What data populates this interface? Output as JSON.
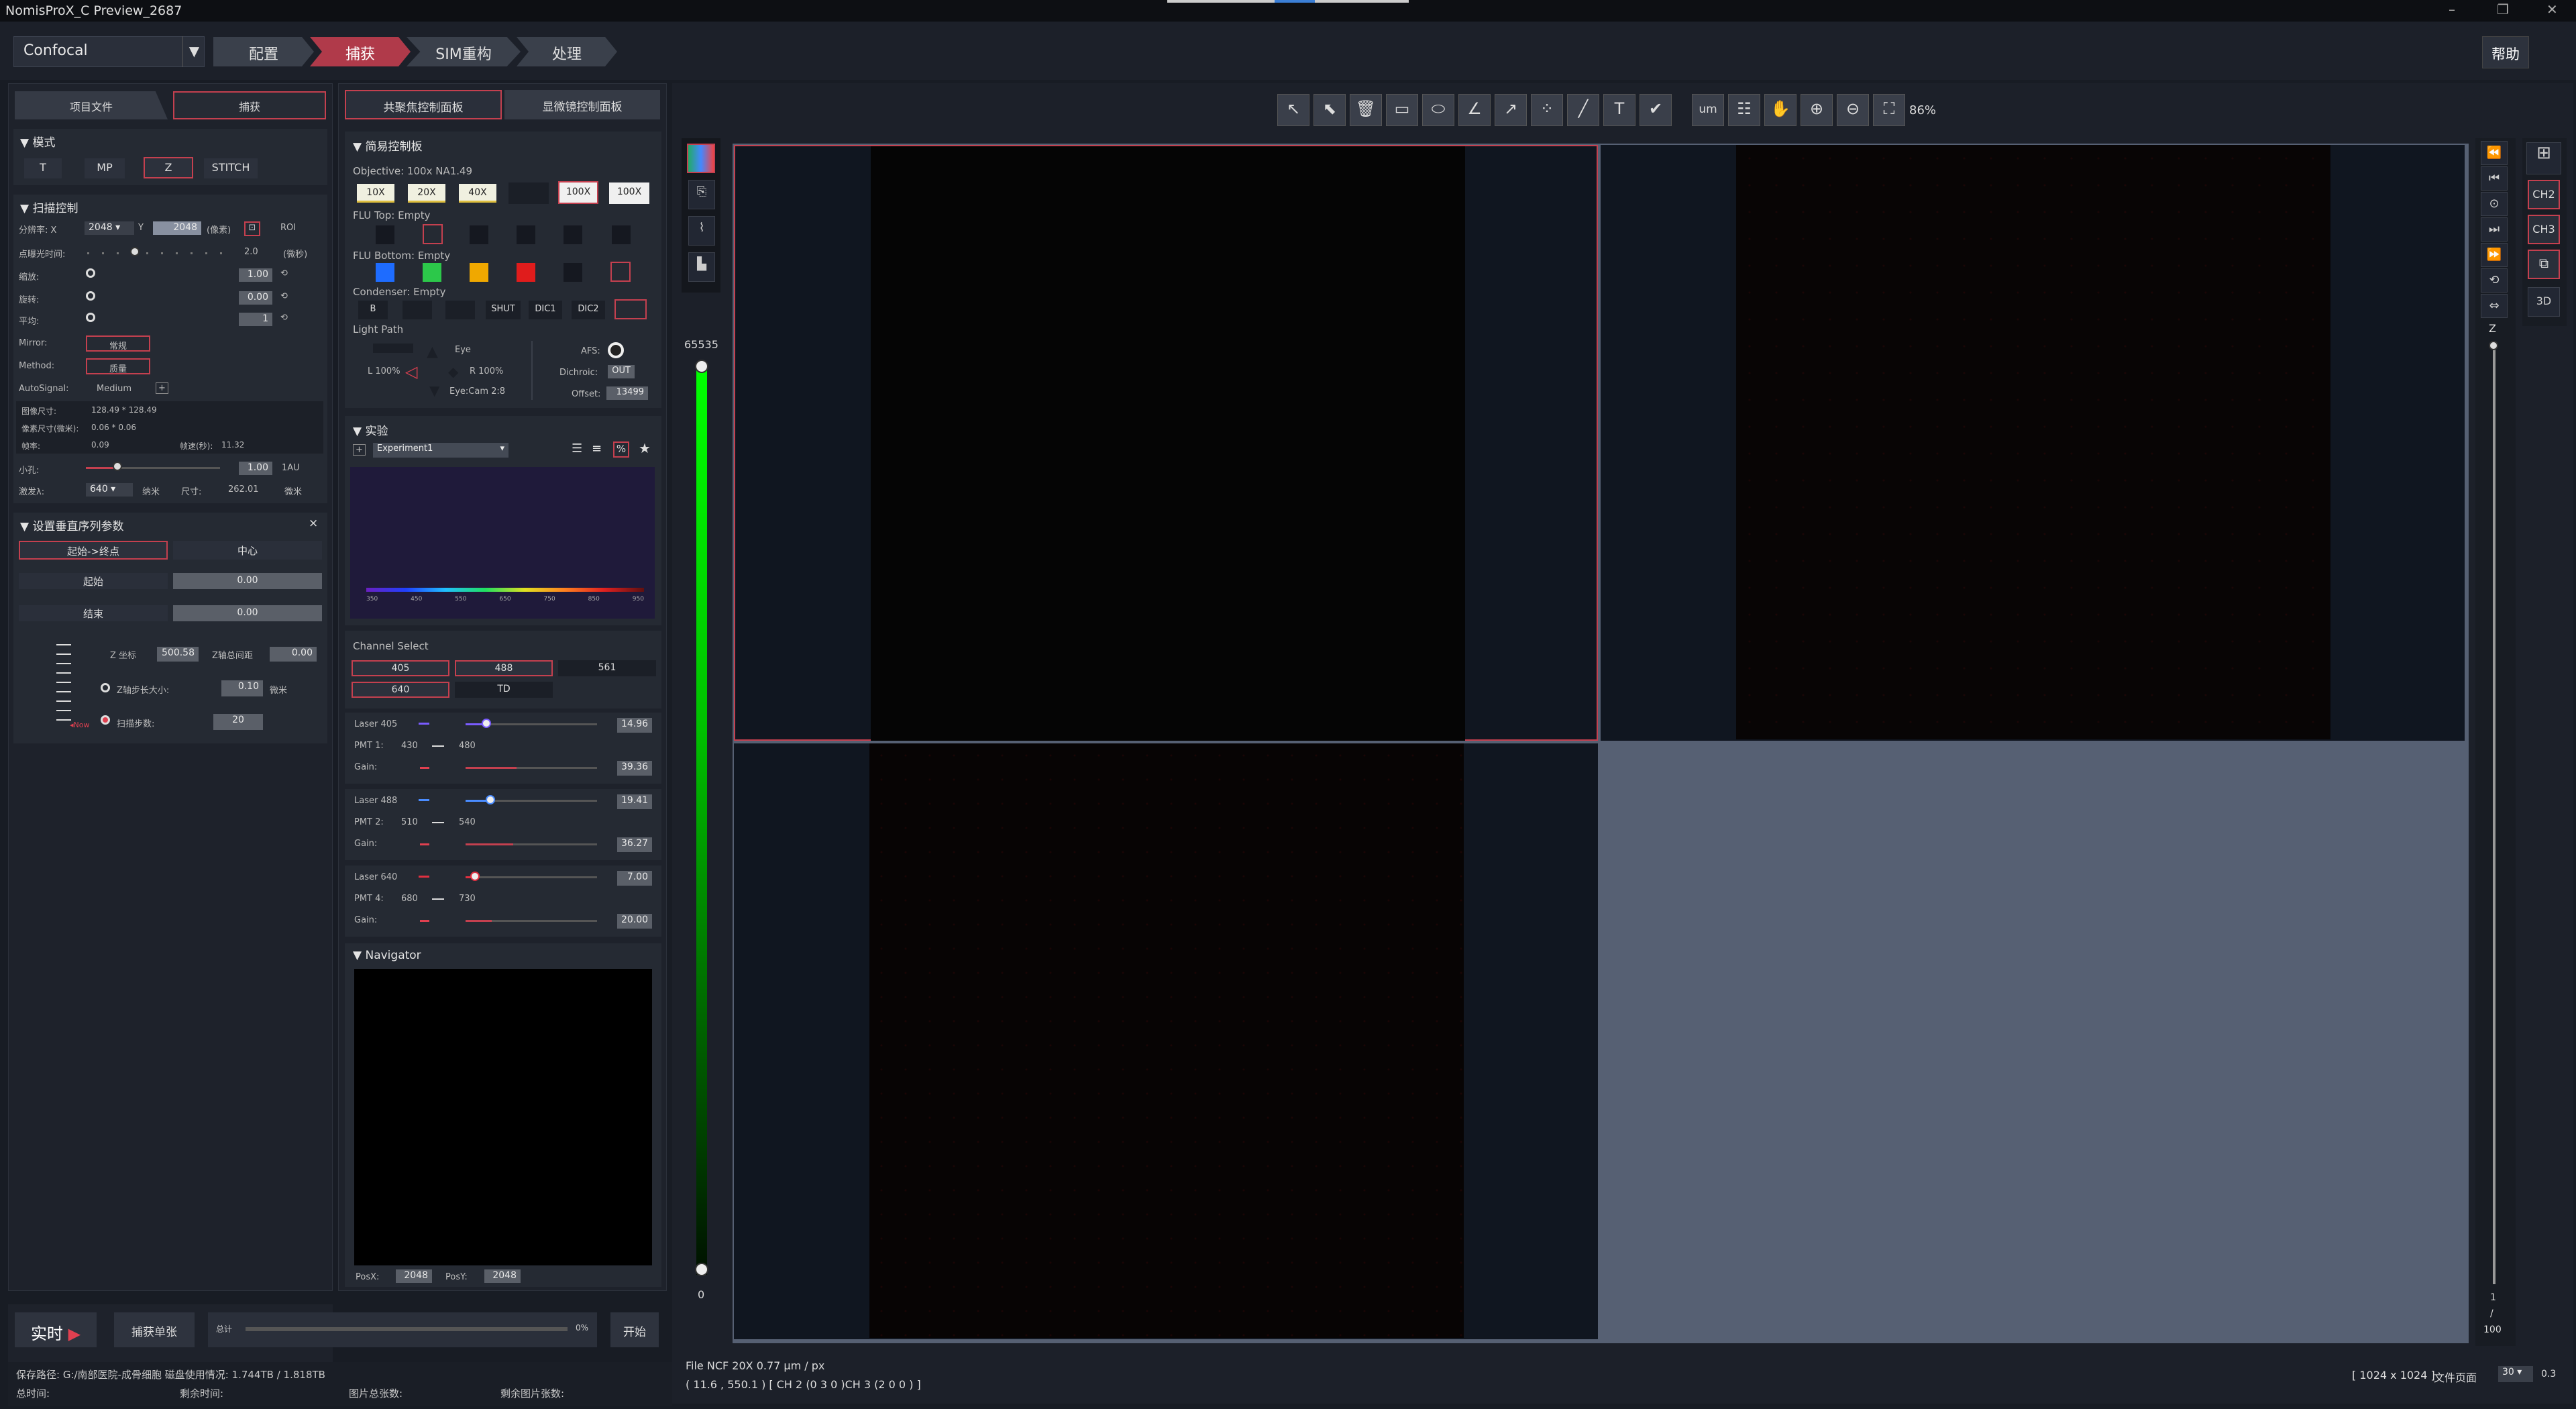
{
  "window": {
    "title": "NomisProX_C Preview_2687"
  },
  "nav": {
    "mode_select": "Confocal",
    "tabs": [
      "配置",
      "捕获",
      "SIM重构",
      "处理"
    ],
    "active_tab": "捕获",
    "help": "帮助"
  },
  "left": {
    "tabs": [
      "项目文件",
      "捕获"
    ],
    "mode": {
      "title": "模式",
      "buttons": [
        "T",
        "MP",
        "Z",
        "STITCH"
      ],
      "active": "Z"
    },
    "scan": {
      "title": "扫描控制",
      "resolution_label": "分辨率: X",
      "res_x": "2048",
      "res_y_label": "Y",
      "res_y": "2048",
      "res_unit": "(像素)",
      "roi": "ROI",
      "dwell_label": "点曝光时间:",
      "dwell_value": "2.0",
      "dwell_unit": "(微秒)",
      "zoom_label": "缩放:",
      "zoom_value": "1.00",
      "rotate_label": "旋转:",
      "rotate_value": "0.00",
      "avg_label": "平均:",
      "avg_value": "1",
      "mirror_label": "Mirror:",
      "mirror_value": "常规",
      "method_label": "Method:",
      "method_value": "质量",
      "autosignal_label": "AutoSignal:",
      "autosignal_value": "Medium",
      "img_size_label": "图像尺寸:",
      "img_size": "128.49 * 128.49",
      "px_size_label": "像素尺寸(微米):",
      "px_size": "0.06 * 0.06",
      "frame_label": "帧率:",
      "frame_rate": "0.09",
      "frame_time_label": "帧速(秒):",
      "frame_time": "11.32",
      "pinhole_label": "小孔:",
      "pinhole_value": "1.00",
      "pinhole_unit": "1AU",
      "excite_label": "激发λ:",
      "excite_value": "640",
      "excite_unit": "纳米",
      "size_label": "尺寸:",
      "size_value": "262.01",
      "size_unit": "微米"
    },
    "zseq": {
      "title": "设置垂直序列参数",
      "close": "×",
      "tab1": "起始->终点",
      "tab2": "中心",
      "start_label": "起始",
      "start_value": "0.00",
      "end_label": "结束",
      "end_value": "0.00",
      "zcoord_label": "Z 坐标",
      "zcoord_value": "500.58",
      "ztotal_label": "Z轴总间距",
      "ztotal_value": "0.00",
      "zstep_label": "Z轴步长大小:",
      "zstep_value": "0.10",
      "zstep_unit": "微米",
      "steps_label": "扫描步数:",
      "steps_value": "20",
      "now_label": "Now"
    },
    "bottom": {
      "live": "实时",
      "snap": "捕获单张",
      "total": "总计",
      "progress_pct": "0%",
      "start": "开始",
      "save_path": "保存路径: G:/南部医院-成骨细胞  磁盘使用情况: 1.744TB / 1.818TB",
      "total_time": "总时间:",
      "remain_time": "剩余时间:",
      "img_total": "图片总张数:",
      "img_remain": "剩余图片张数:"
    }
  },
  "mid": {
    "tabs": [
      "共聚焦控制面板",
      "显微镜控制面板"
    ],
    "simple": {
      "title": "简易控制板",
      "objective": "Objective: 100x NA1.49",
      "obj_buttons": [
        "10X",
        "20X",
        "40X",
        "",
        "100X",
        "100X"
      ],
      "flu_top": "FLU Top: Empty",
      "flu_bottom": "FLU Bottom: Empty",
      "condenser": "Condenser: Empty",
      "cond_buttons": [
        "B",
        "",
        "",
        "SHUT",
        "DIC1",
        "DIC2"
      ],
      "light_path": "Light Path",
      "eye": "Eye",
      "l100": "L 100%",
      "r100": "R 100%",
      "eyecam": "Eye:Cam 2:8",
      "afs": "AFS:",
      "dichroic": "Dichroic:",
      "dichroic_value": "OUT",
      "offset": "Offset:",
      "offset_value": "13499"
    },
    "experiment": {
      "title": "实验",
      "select": "Experiment1",
      "wavelengths": [
        "350",
        "450",
        "550",
        "650",
        "750",
        "850",
        "950"
      ]
    },
    "channel": {
      "title": "Channel Select",
      "buttons": [
        "405",
        "488",
        "561",
        "640",
        "TD"
      ]
    },
    "lasers": [
      {
        "name": "Laser 405",
        "value": "14.96",
        "pmt": "PMT 1:",
        "lo": "430",
        "hi": "480",
        "gain": "Gain:",
        "gain_value": "39.36",
        "level": 0.16,
        "gain_level": 0.39,
        "color": "#7a5cff"
      },
      {
        "name": "Laser 488",
        "value": "19.41",
        "pmt": "PMT 2:",
        "lo": "510",
        "hi": "540",
        "gain": "Gain:",
        "gain_value": "36.27",
        "level": 0.19,
        "gain_level": 0.36,
        "color": "#4a8cff"
      },
      {
        "name": "Laser 640",
        "value": "7.00",
        "pmt": "PMT 4:",
        "lo": "680",
        "hi": "730",
        "gain": "Gain:",
        "gain_value": "20.00",
        "level": 0.07,
        "gain_level": 0.2,
        "color": "#e03040"
      }
    ],
    "navigator": {
      "title": "Navigator",
      "posx_label": "PosX:",
      "posx": "2048",
      "posy_label": "PosY:",
      "posy": "2048"
    }
  },
  "viewer": {
    "zoom": "86%",
    "um_label": "um",
    "lut_max": "65535",
    "lut_min": "0",
    "status1": "File NCF 20X 0.77 µm / px",
    "status2": "( 11.6 , 550.1 ) [ CH 2  (0 3 0 )CH 3  (2 0 0 ) ]",
    "dims": "[ 1024 x 1024 ]",
    "page_label": "文件页面",
    "page_value": "30",
    "page_extra": "0.3",
    "z_label": "Z",
    "z_top": "1",
    "z_sep": "/",
    "z_total": "100",
    "right_buttons": [
      "CH2",
      "CH3",
      "3D"
    ]
  },
  "colors": {
    "accent": "#c4404f",
    "lut": "#00e000"
  }
}
